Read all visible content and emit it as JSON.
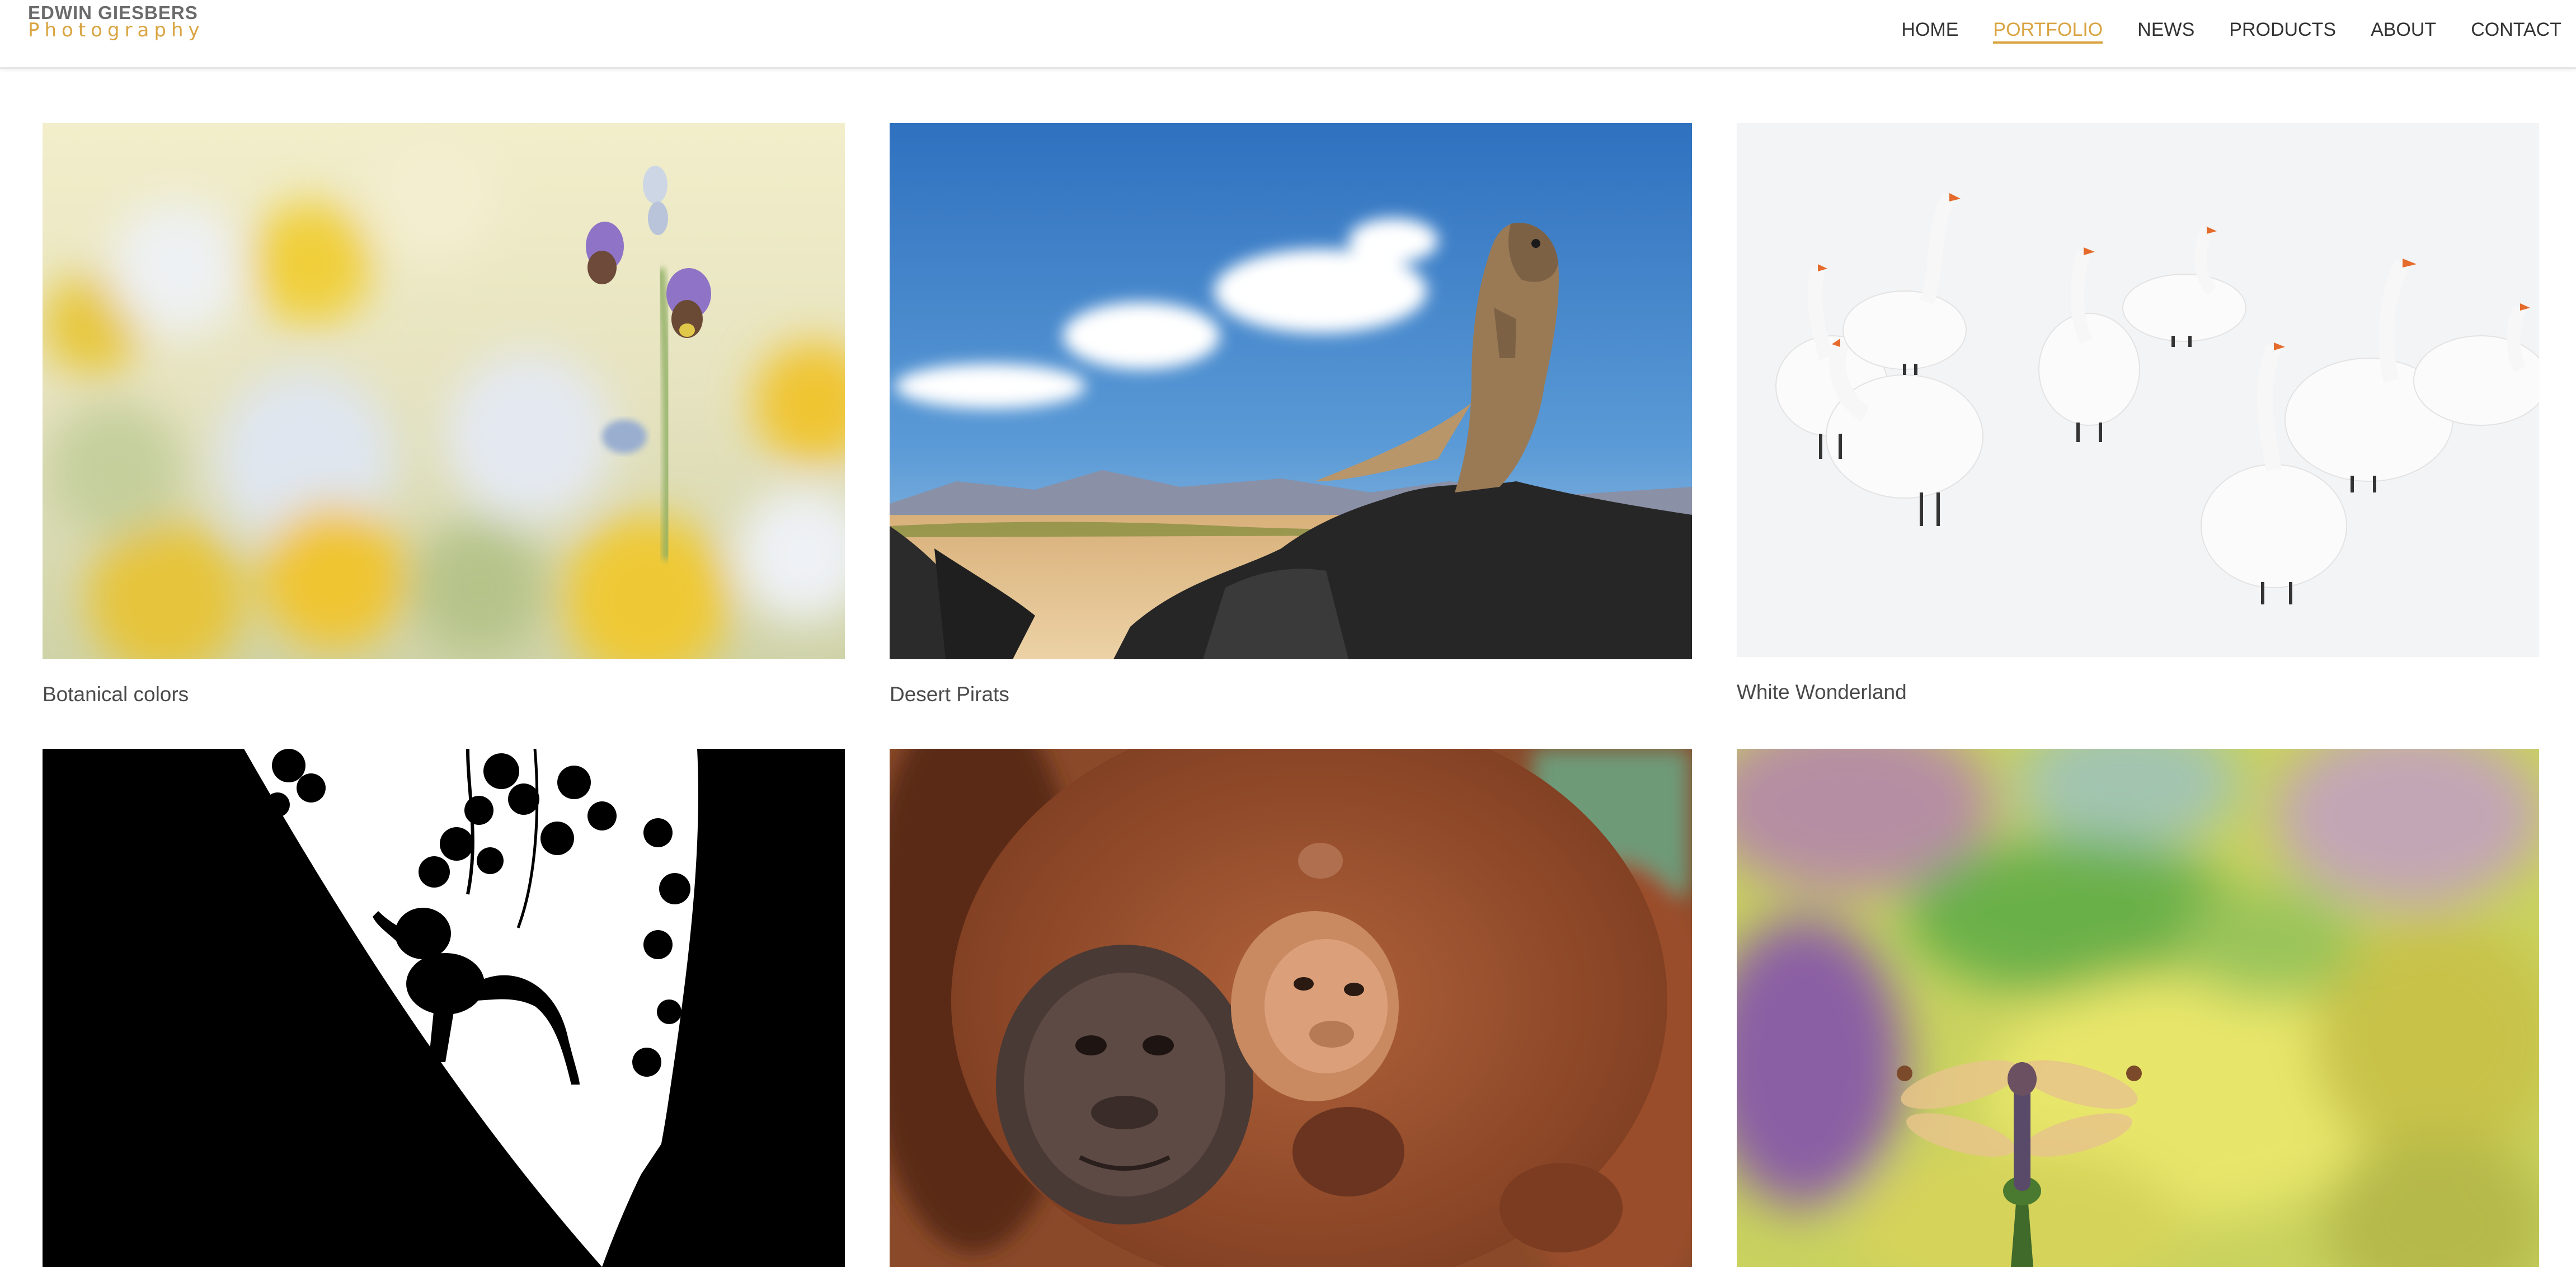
{
  "brand": {
    "name": "EDWIN GIESBERS",
    "tagline": "Photography",
    "accent_color": "#d9a441"
  },
  "nav": {
    "items": [
      {
        "label": "HOME",
        "active": false
      },
      {
        "label": "PORTFOLIO",
        "active": true
      },
      {
        "label": "NEWS",
        "active": false
      },
      {
        "label": "PRODUCTS",
        "active": false
      },
      {
        "label": "ABOUT",
        "active": false
      },
      {
        "label": "CONTACT",
        "active": false
      }
    ]
  },
  "gallery": {
    "items": [
      {
        "title": "Botanical colors",
        "image": "bee-orchid-in-blurred-flower-meadow"
      },
      {
        "title": "Desert Pirats",
        "image": "ground-squirrel-standing-on-lava-rock"
      },
      {
        "title": "White Wonderland",
        "image": "mute-swans-on-snow"
      },
      {
        "title": "",
        "image": "monkey-silhouette-on-tree"
      },
      {
        "title": "",
        "image": "orangutan-mother-and-baby"
      },
      {
        "title": "",
        "image": "dragonfly-on-flower-bokeh"
      }
    ]
  }
}
